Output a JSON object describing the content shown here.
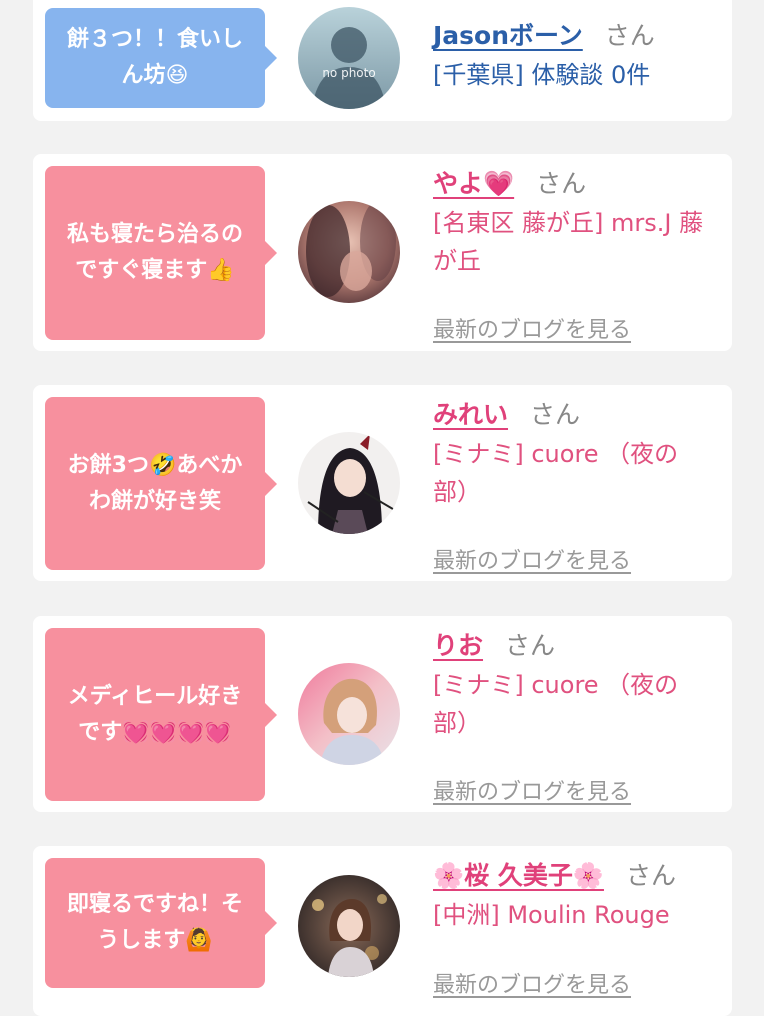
{
  "colors": {
    "page_background": "#f2f2f2",
    "card_background": "#ffffff",
    "bubble_blue": "#87b4ee",
    "bubble_pink": "#f7909e",
    "name_blue": "#2b5fa8",
    "name_pink": "#e0417a",
    "link_gray": "#999999"
  },
  "entries": [
    {
      "comment": "餅３つ！！食いし\nん坊😆",
      "bubble_style": "blue",
      "avatar": "no photo",
      "name": "Jasonボーン",
      "honorific": "さん",
      "affiliation": "[千葉県] 体験談 0件"
    },
    {
      "comment": "私も寝たら治るの\nですぐ寝ます👍",
      "bubble_style": "pink",
      "avatar": "avatar-photo",
      "name": "やよ💗",
      "honorific": "さん",
      "affiliation": "[名東区 藤が丘] mrs.J 藤が丘",
      "blog_link": "最新のブログを見る"
    },
    {
      "comment": "お餅3つ🤣あべか\nわ餅が好き笑",
      "bubble_style": "pink",
      "avatar": "avatar-illustration",
      "name": "みれい",
      "honorific": "さん",
      "affiliation": "[ミナミ] cuore （夜の部）",
      "blog_link": "最新のブログを見る"
    },
    {
      "comment": "メディヒール好き\nです💓💓💓💓",
      "bubble_style": "pink",
      "avatar": "avatar-photo",
      "name": "りお",
      "honorific": "さん",
      "affiliation": "[ミナミ] cuore （夜の部）",
      "blog_link": "最新のブログを見る"
    },
    {
      "comment": "即寝るですね！そ\nうします🙆",
      "bubble_style": "pink",
      "avatar": "avatar-photo",
      "name": "🌸桜 久美子🌸",
      "honorific": "さん",
      "affiliation": "[中洲] Moulin Rouge",
      "blog_link": "最新のブログを見る"
    }
  ]
}
